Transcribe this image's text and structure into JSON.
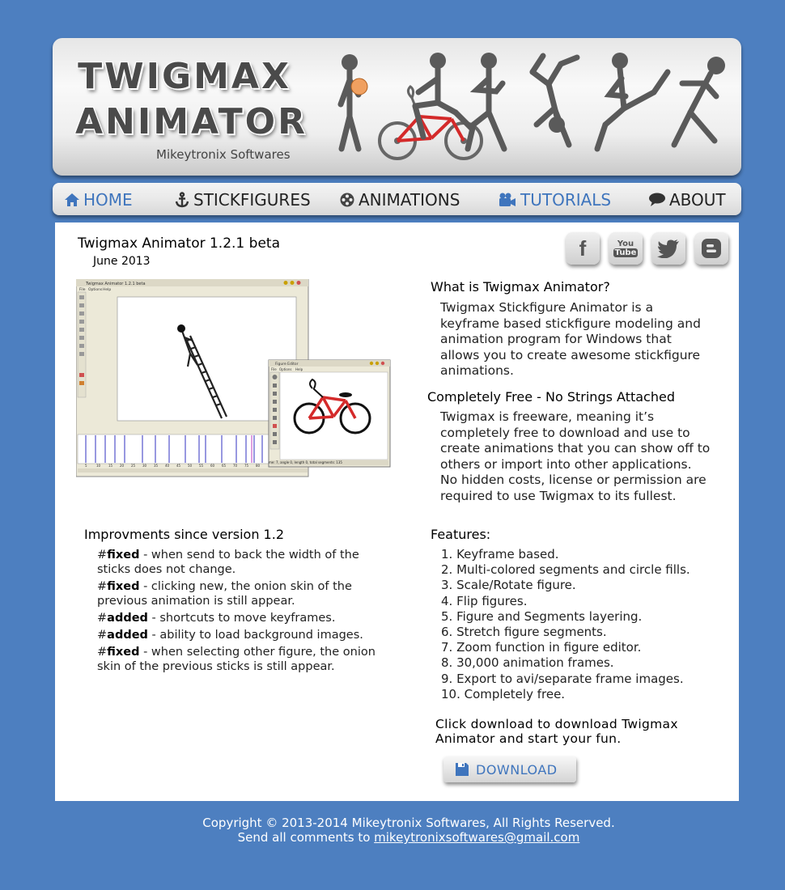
{
  "header": {
    "logo_line_1": "TWIGMAX",
    "logo_line_2": "ANIMATOR",
    "company": "Mikeytronix Softwares"
  },
  "nav": {
    "items": [
      {
        "label": "HOME",
        "icon": "home-icon",
        "active": true
      },
      {
        "label": "STICKFIGURES",
        "icon": "anchor-icon",
        "active": false
      },
      {
        "label": "ANIMATIONS",
        "icon": "film-reel-icon",
        "active": false
      },
      {
        "label": "TUTORIALS",
        "icon": "video-camera-icon",
        "active": true
      },
      {
        "label": "ABOUT",
        "icon": "speech-bubble-icon",
        "active": false
      }
    ]
  },
  "release": {
    "title": "Twigmax Animator 1.2.1 beta",
    "date": "June 2013"
  },
  "social": {
    "facebook": "f",
    "youtube_1": "You",
    "youtube_2": "Tube"
  },
  "screenshot": {
    "main_window_title": "Twigmax Animator 1.2.1 beta",
    "menu": [
      "File",
      "Options",
      "Help"
    ],
    "figure_editor_title": "Figure Editor",
    "status_text": "me: 7, angle 0, length 0, total segments: 135",
    "timeline_ticks": [
      "5",
      "10",
      "15",
      "20",
      "25",
      "30",
      "35",
      "40",
      "45",
      "50",
      "55",
      "60",
      "65",
      "70",
      "75",
      "80"
    ]
  },
  "what": {
    "heading": "What is Twigmax Animator?",
    "text": "Twigmax Stickfigure Animator is a keyframe based stickfigure modeling and animation program for Windows that allows you to create awesome stickfigure animations."
  },
  "free": {
    "heading": "Completely Free - No Strings Attached",
    "text": "Twigmax is freeware, meaning it’s completely free to download and use to create animations that you can show off to others or import into other applications. No hidden costs, license or permission are required to use Twigmax to its fullest."
  },
  "improvements": {
    "heading": "Improvments since version 1.2",
    "items": [
      {
        "tag": "fixed",
        "text": " - when send to back the width of the sticks does not change."
      },
      {
        "tag": "fixed",
        "text": " - clicking new, the onion skin of the previous animation is still appear."
      },
      {
        "tag": "added",
        "text": " - shortcuts to move keyframes."
      },
      {
        "tag": "added",
        "text": " - ability to load background images."
      },
      {
        "tag": "fixed",
        "text": " - when selecting other figure, the onion skin of the previous sticks is still appear."
      }
    ]
  },
  "features": {
    "heading": "Features:",
    "items": [
      "1. Keyframe based.",
      "2. Multi-colored segments and circle fills.",
      "3. Scale/Rotate figure.",
      "4. Flip figures.",
      "5. Figure and Segments layering.",
      "6. Stretch figure segments.",
      "7. Zoom function in figure editor.",
      "8. 30,000 animation frames.",
      "9. Export to avi/separate frame images.",
      "10. Completely free."
    ]
  },
  "cta": {
    "text": "Click download to download Twigmax Animator and start your fun.",
    "button": "DOWNLOAD"
  },
  "footer": {
    "copyright": "Copyright © 2013-2014 Mikeytronix Softwares, All Rights Reserved.",
    "comments_prefix": "Send all comments to ",
    "email": "mikeytronixsoftwares@gmail.com"
  },
  "colors": {
    "background": "#4d7fc0",
    "accent": "#3f75bd",
    "bike_red": "#d42a2a",
    "ball_orange": "#f0a060"
  }
}
